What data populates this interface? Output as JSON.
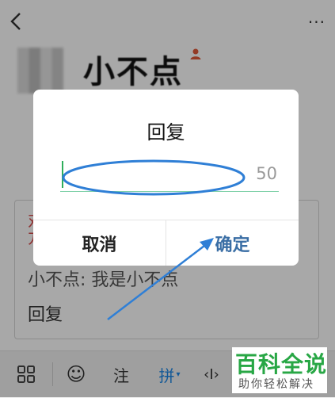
{
  "header": {
    "more_label": "···"
  },
  "profile": {
    "name": "小不点"
  },
  "card": {
    "red_text": "对方",
    "message": "小不点: 我是小不点",
    "reply_label": "回复"
  },
  "dialog": {
    "title": "回复",
    "input_value": "",
    "counter": "50",
    "cancel_label": "取消",
    "confirm_label": "确定"
  },
  "keyboard": {
    "emoji_label": "☺",
    "note_label": "注",
    "pinyin_label": "拼",
    "cursor_label": "‹I›",
    "colors": {
      "pinyin": "#1e88e5"
    }
  },
  "annotation": {
    "color": "#2f7fd6"
  },
  "watermark": {
    "main": "百科全说",
    "sub": "助你轻松解决",
    "color": "#28a745"
  }
}
